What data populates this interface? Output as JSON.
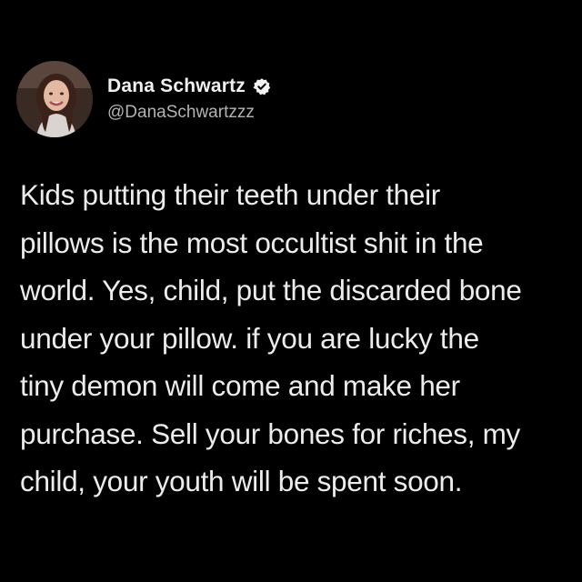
{
  "tweet": {
    "author": {
      "display_name": "Dana Schwartz",
      "handle": "@DanaSchwartzzz",
      "verified_icon": "verified-badge-icon",
      "avatar": "profile-photo"
    },
    "text": "Kids putting their teeth under their\npillows is the most occultist shit in the\nworld. Yes, child, put the discarded bone\nunder your pillow. if you are lucky the\ntiny demon will come and make her\npurchase. Sell your bones for riches, my\nchild, your youth will be spent soon."
  },
  "colors": {
    "background": "#000000",
    "text": "#ececec",
    "handle": "#b3b3b3"
  }
}
